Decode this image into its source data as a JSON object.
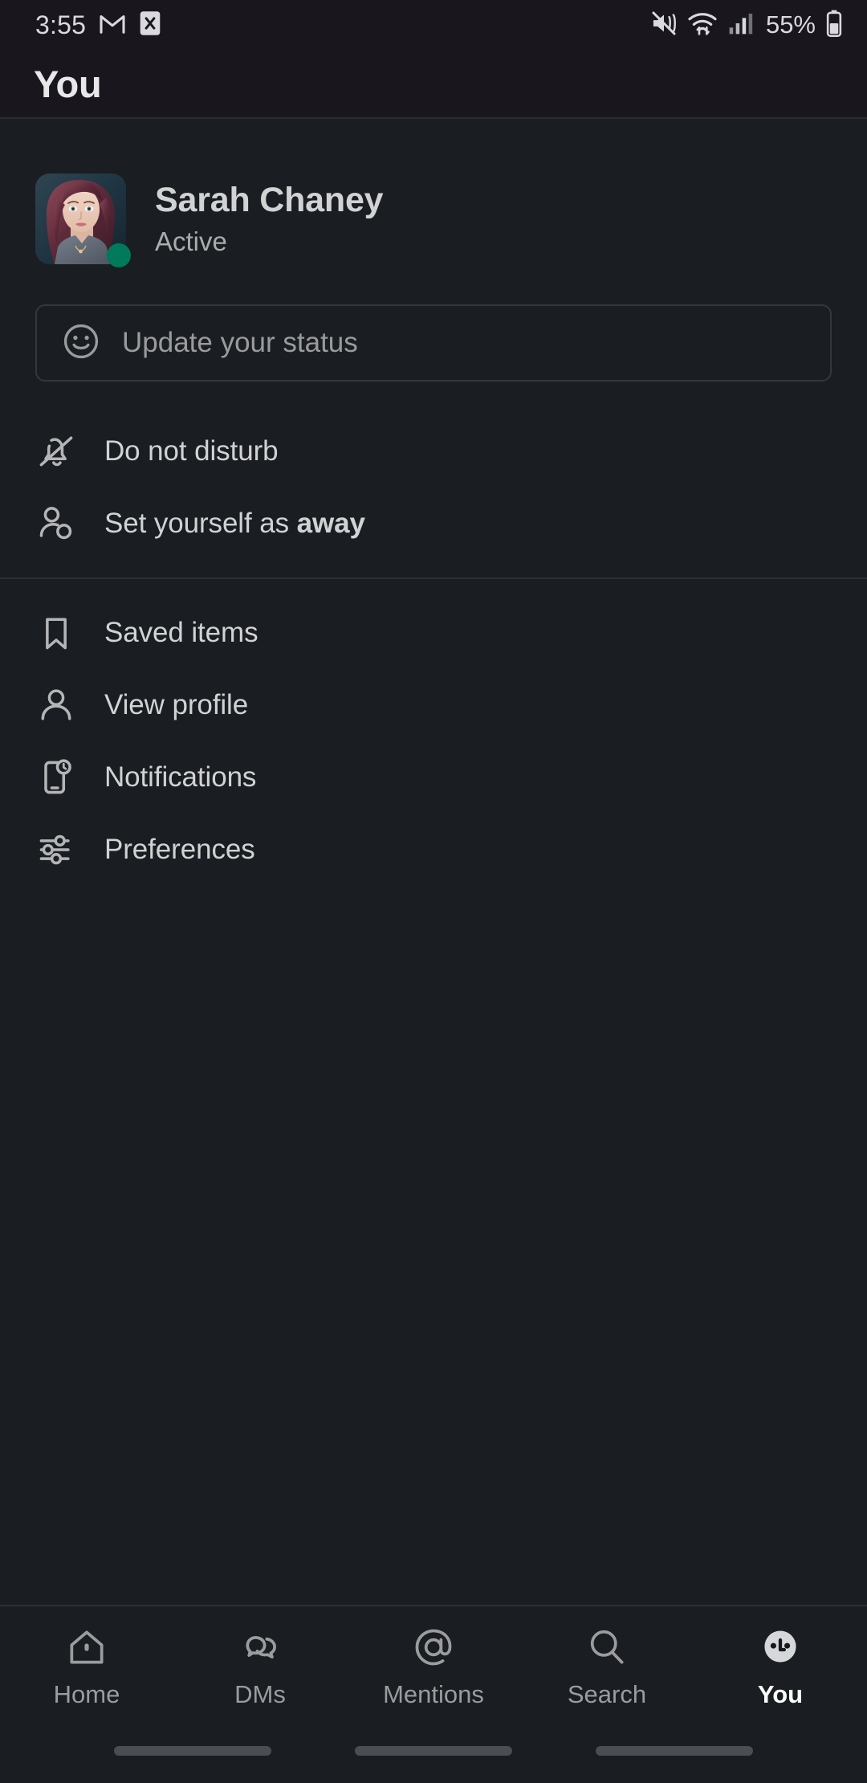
{
  "status_bar": {
    "time": "3:55",
    "battery_percent": "55%",
    "left_icons": [
      "gmail-icon",
      "x-app-icon"
    ],
    "right_icons": [
      "ringer-vibrate-off-icon",
      "wifi-icon",
      "cellular-signal-icon",
      "battery-icon"
    ]
  },
  "header": {
    "title": "You"
  },
  "profile": {
    "name": "Sarah Chaney",
    "presence_label": "Active",
    "presence_color": "#007a5a",
    "avatar_name": "user-avatar-photo"
  },
  "status_input": {
    "placeholder": "Update your status",
    "icon": "smiley-face-icon"
  },
  "menu": {
    "groups": [
      {
        "items": [
          {
            "label": "Do not disturb",
            "icon": "bell-slash-icon",
            "bold_suffix": ""
          },
          {
            "label": "Set yourself as ",
            "icon": "person-away-icon",
            "bold_suffix": "away"
          }
        ]
      },
      {
        "items": [
          {
            "label": "Saved items",
            "icon": "bookmark-icon",
            "bold_suffix": ""
          },
          {
            "label": "View profile",
            "icon": "person-icon",
            "bold_suffix": ""
          },
          {
            "label": "Notifications",
            "icon": "mobile-notification-icon",
            "bold_suffix": ""
          },
          {
            "label": "Preferences",
            "icon": "sliders-icon",
            "bold_suffix": ""
          }
        ]
      }
    ]
  },
  "bottom_nav": {
    "items": [
      {
        "label": "Home",
        "icon": "home-icon",
        "active": false
      },
      {
        "label": "DMs",
        "icon": "speech-bubbles-icon",
        "active": false
      },
      {
        "label": "Mentions",
        "icon": "at-sign-icon",
        "active": false
      },
      {
        "label": "Search",
        "icon": "magnifier-icon",
        "active": false
      },
      {
        "label": "You",
        "icon": "you-face-avatar-icon",
        "active": true
      }
    ],
    "active_index": 4
  },
  "colors": {
    "background": "#1a1d21",
    "header_background": "#19171d",
    "text_primary": "#d1d2d3",
    "text_secondary": "#ababad",
    "divider": "#2c2f33",
    "presence_active": "#007a5a"
  }
}
